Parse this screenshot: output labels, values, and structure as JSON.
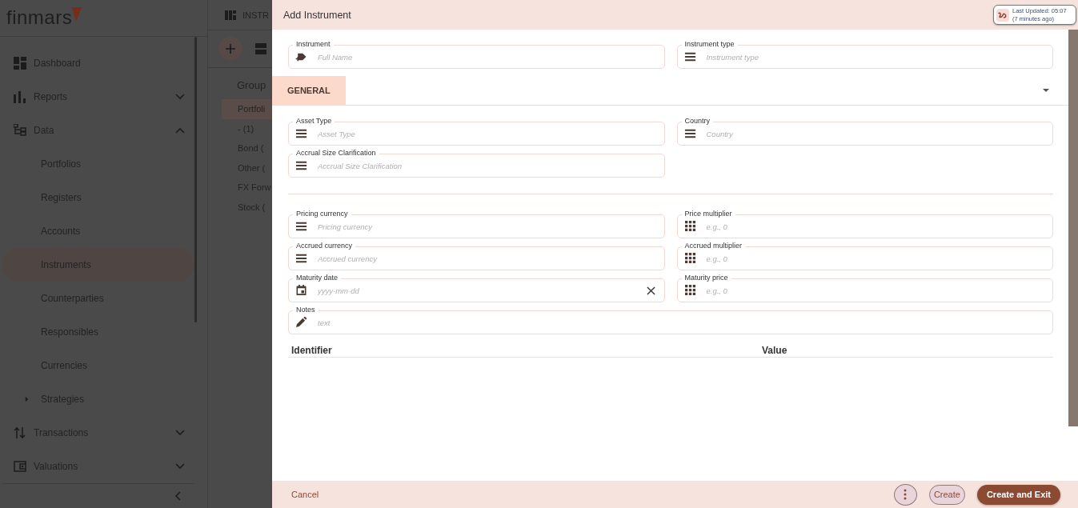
{
  "app": {
    "logo": "finmars",
    "sidebar": {
      "items": [
        {
          "label": "Dashboard",
          "kind": "dashboard",
          "selected": false
        },
        {
          "label": "Reports",
          "kind": "reports",
          "selected": false,
          "expanded": false
        },
        {
          "label": "Data",
          "kind": "data",
          "selected": false,
          "expanded": true,
          "children": [
            {
              "label": "Portfolios",
              "selected": false
            },
            {
              "label": "Registers",
              "selected": false
            },
            {
              "label": "Accounts",
              "selected": false
            },
            {
              "label": "Instruments",
              "selected": true
            },
            {
              "label": "Counterparties",
              "selected": false
            },
            {
              "label": "Responsibles",
              "selected": false
            },
            {
              "label": "Currencies",
              "selected": false
            },
            {
              "label": "Strategies",
              "selected": false,
              "expanded": false
            }
          ]
        },
        {
          "label": "Transactions",
          "kind": "transactions",
          "selected": false,
          "expanded": false
        },
        {
          "label": "Valuations",
          "kind": "valuations",
          "selected": false,
          "expanded": false
        }
      ]
    },
    "page_title": "INSTR",
    "group_header": "Group",
    "group_rows": [
      {
        "label": "Portfoli",
        "selected": true
      },
      {
        "label": "- (1)",
        "selected": false
      },
      {
        "label": "Bond (",
        "selected": false
      },
      {
        "label": "Other (",
        "selected": false
      },
      {
        "label": "FX Forw",
        "selected": false
      },
      {
        "label": "Stock (",
        "selected": false
      }
    ]
  },
  "dialog": {
    "title": "Add Instrument",
    "last_updated": "Last Updated: 05:07 (7 minutes ago)",
    "top_fields": [
      {
        "label": "Instrument",
        "placeholder": "Full Name",
        "kind": "text"
      },
      {
        "label": "Instrument type",
        "placeholder": "Instrument type",
        "kind": "select"
      }
    ],
    "section": {
      "label": "GENERAL",
      "selected": true,
      "expanded": true
    },
    "general_fields": [
      {
        "label": "Asset Type",
        "placeholder": "Asset Type",
        "kind": "select"
      },
      {
        "label": "Country",
        "placeholder": "Country",
        "kind": "select"
      },
      {
        "label": "Accrual Size Clarification",
        "placeholder": "Accrual Size Clarification",
        "kind": "select"
      }
    ],
    "pricing_fields": [
      {
        "label": "Pricing currency",
        "placeholder": "Pricing currency",
        "kind": "select"
      },
      {
        "label": "Price multiplier",
        "placeholder": "e.g., 0",
        "kind": "number"
      },
      {
        "label": "Accrued currency",
        "placeholder": "Accrued currency",
        "kind": "select"
      },
      {
        "label": "Accrued multiplier",
        "placeholder": "e.g., 0",
        "kind": "number"
      },
      {
        "label": "Maturity date",
        "placeholder": "yyyy-mm-dd",
        "kind": "date",
        "clearable": true
      },
      {
        "label": "Maturity price",
        "placeholder": "e.g., 0",
        "kind": "number"
      }
    ],
    "notes": {
      "label": "Notes",
      "placeholder": "text",
      "kind": "textarea"
    },
    "table": {
      "columns": [
        "Identifier",
        "Value"
      ]
    },
    "footer": {
      "cancel": "Cancel",
      "create": "Create",
      "create_and_exit": "Create and Exit"
    }
  }
}
